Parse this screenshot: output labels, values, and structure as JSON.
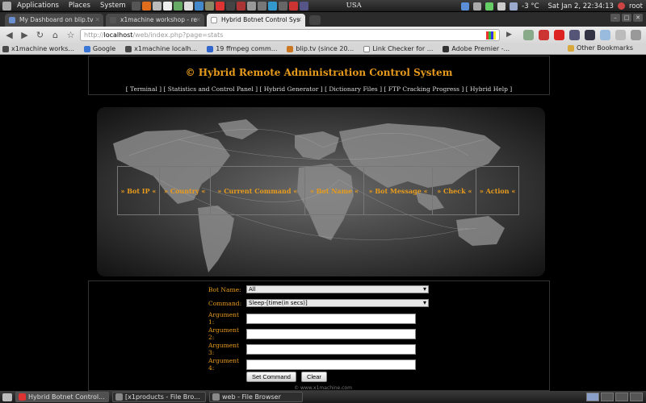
{
  "top_panel": {
    "menus": [
      "Applications",
      "Places",
      "System"
    ],
    "region": "USA",
    "temperature": "-3 °C",
    "clock": "Sat Jan  2, 22:34:13",
    "user": "root"
  },
  "tabs": [
    {
      "title": "My Dashboard on blip.tv",
      "active": false
    },
    {
      "title": "x1machine workshop - re",
      "active": false
    },
    {
      "title": "Hybrid Botnet Control Sys",
      "active": true
    }
  ],
  "toolbar": {
    "url_scheme": "http://",
    "url_host": "localhost",
    "url_path": "/web/index.php?page=stats"
  },
  "bookmarks": [
    {
      "label": "x1machine works...",
      "color": "#4a4a4a"
    },
    {
      "label": "Google",
      "color": "#3a76d6"
    },
    {
      "label": "x1machine localh...",
      "color": "#4a4a4a"
    },
    {
      "label": "19 ffmpeg comm...",
      "color": "#3366cc"
    },
    {
      "label": "blip.tv (since 20...",
      "color": "#cc7722"
    },
    {
      "label": "Link Checker for ...",
      "color": "#ffffff"
    },
    {
      "label": "Adobe Premier -...",
      "color": "#333333"
    }
  ],
  "other_bookmarks": "Other Bookmarks",
  "page": {
    "title": "© Hybrid Remote Administration Control System",
    "nav_links": "[ Terminal ] [ Statistics and Control Panel ] [ Hybrid Generator ] [ Dictionary Files ] [ FTP Cracking Progress ] [ Hybrid Help ]",
    "columns": [
      "» Bot IP «",
      "» Country «",
      "» Current Command «",
      "» Bot Name «",
      "» Bot Message «",
      "» Check «",
      "» Action «"
    ],
    "form": {
      "bot_name_label": "Bot Name:",
      "bot_name_value": "All",
      "command_label": "Command:",
      "command_value": "Sleep-[time(in secs)]",
      "arg1_label": "Argument 1:",
      "arg2_label": "Argument 2:",
      "arg3_label": "Argument 3:",
      "arg4_label": "Argument 4:",
      "set_command": "Set Command",
      "clear": "Clear"
    },
    "footer": "© www.x1machine.com"
  },
  "taskbar": [
    {
      "label": "Hybrid Botnet Control...",
      "active": true
    },
    {
      "label": "[x1products - File Bro...",
      "active": false
    },
    {
      "label": "web - File Browser",
      "active": false
    }
  ],
  "colors": {
    "accent": "#e79b1d",
    "page_bg": "#000000"
  }
}
